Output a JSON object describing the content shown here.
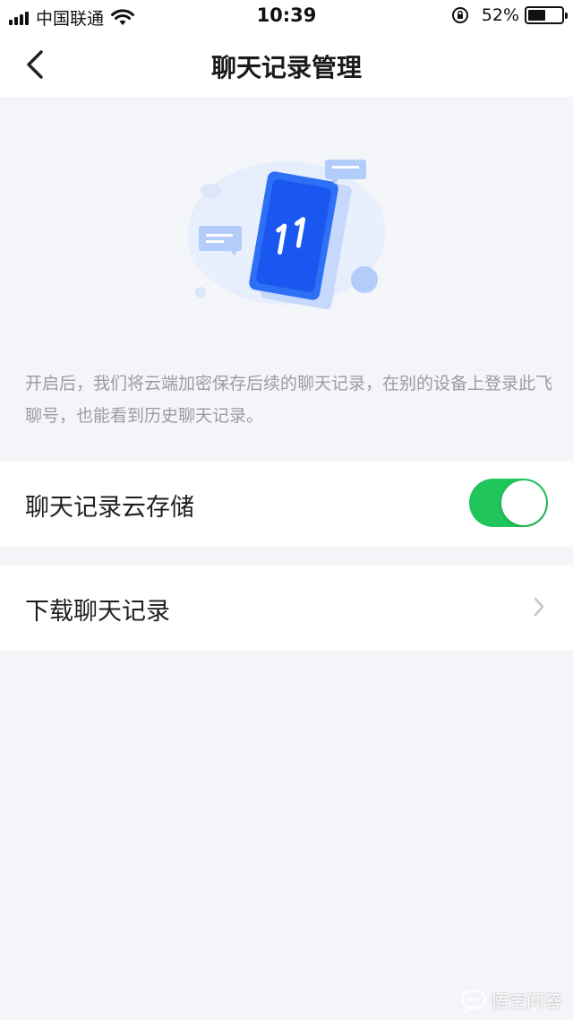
{
  "status_bar": {
    "carrier": "中国联通",
    "time": "10:39",
    "battery_percent": "52%",
    "battery_level": 0.52,
    "icons": [
      "signal-icon",
      "wifi-icon",
      "orientation-lock-icon",
      "battery-icon"
    ]
  },
  "nav": {
    "title": "聊天记录管理",
    "back_icon": "chevron-left-icon"
  },
  "illustration": {
    "icon": "cloud-phone-sync-icon"
  },
  "description": "开启后，我们将云端加密保存后续的聊天记录，在别的设备上登录此飞聊号，也能看到历史聊天记录。",
  "settings": {
    "cloud_storage": {
      "label": "聊天记录云存储",
      "enabled": true
    },
    "download": {
      "label": "下载聊天记录",
      "icon": "chevron-right-icon"
    }
  },
  "watermark": {
    "text": "悟空问答"
  },
  "colors": {
    "accent_green": "#1fc45b",
    "background": "#f4f5f9",
    "illustration_blue": "#1a56f0",
    "muted_text": "#9a9ca3"
  }
}
